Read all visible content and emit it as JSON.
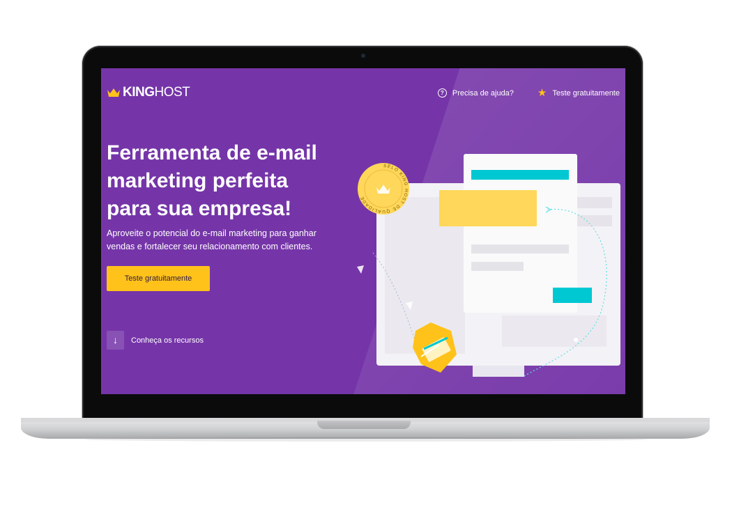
{
  "header": {
    "logo_text_bold": "KING",
    "logo_text_light": "HOST",
    "nav": {
      "help_label": "Precisa de ajuda?",
      "trial_label": "Teste gratuitamente"
    }
  },
  "hero": {
    "title": "Ferramenta de e-mail marketing perfeita para sua empresa!",
    "subtitle": "Aproveite o potencial do e-mail marketing para ganhar vendas e fortalecer seu relacionamento com clientes.",
    "cta_label": "Teste gratuitamente",
    "explore_label": "Conheça os recursos"
  },
  "illustration": {
    "seal_text": "SELO KING HOST DE QUALIDADE"
  },
  "icons": {
    "logo": "crown-icon",
    "help": "question-circle-icon",
    "trial": "star-icon",
    "explore": "arrow-down-icon"
  },
  "colors": {
    "background": "#7535a8",
    "accent": "#ffc21a",
    "teal": "#00c8d2",
    "text": "#ffffff"
  }
}
